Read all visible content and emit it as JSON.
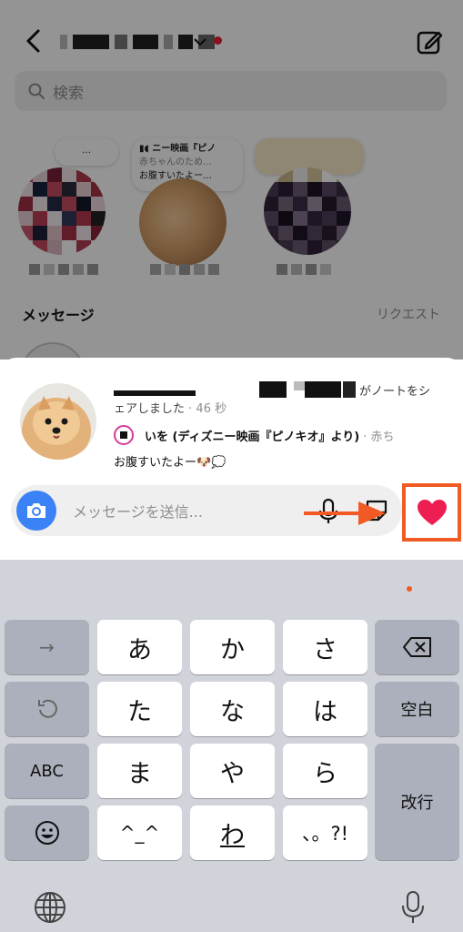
{
  "header": {
    "back_icon": "chevron-left-icon",
    "compose_icon": "compose-icon",
    "has_notification_dot": true
  },
  "search": {
    "placeholder": "検索"
  },
  "notes": [
    {
      "bubble": "…",
      "avatar": "pixelated"
    },
    {
      "bubble_line1": "ニー映画『ピノ",
      "bubble_line2": "赤ちゃんのため…",
      "bubble_line3": "お腹すいたよー…",
      "avatar": "pomeranian"
    },
    {
      "bubble": "",
      "avatar": "pixelated"
    }
  ],
  "section": {
    "title": "メッセージ",
    "request": "リクエスト"
  },
  "sheet": {
    "shared_suffix": "がノートをシ",
    "shared_line2": "ェアしました",
    "time": "· 46 秒",
    "song_title": "いを (ディズニー映画『ピノキオ』より)",
    "song_artist": "· 赤ち",
    "note_text": "お腹すいたよー🐶💭"
  },
  "composer": {
    "placeholder": "メッセージを送信...",
    "camera_icon": "camera-icon",
    "mic_icon": "microphone-icon",
    "sticker_icon": "sticker-icon",
    "heart_icon": "heart-icon",
    "heart_color": "#ee1d52",
    "annotation_color": "#f15a24"
  },
  "keyboard": {
    "row1": {
      "left": "→",
      "keys": [
        "あ",
        "か",
        "さ"
      ],
      "right_icon": "backspace-icon"
    },
    "row2": {
      "left_icon": "undo-icon",
      "keys": [
        "た",
        "な",
        "は"
      ],
      "right": "空白"
    },
    "row3": {
      "left": "ABC",
      "keys": [
        "ま",
        "や",
        "ら"
      ],
      "right": "改行"
    },
    "row4": {
      "left_icon": "emoji-icon",
      "keys": [
        "^_^",
        "わ",
        "、。?!"
      ]
    },
    "globe_icon": "globe-icon",
    "dictation_icon": "microphone-icon"
  }
}
